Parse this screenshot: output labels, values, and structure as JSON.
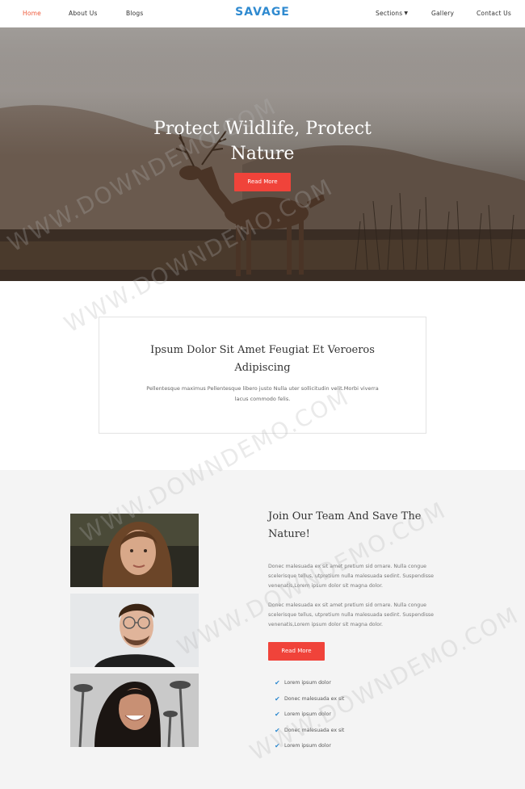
{
  "nav": {
    "logo": "SAVAGE",
    "links": [
      "Home",
      "About Us",
      "Blogs",
      "Sections",
      "Gallery",
      "Contact Us"
    ]
  },
  "hero": {
    "title_line1": "Protect Wildlife, Protect",
    "title_line2": "Nature",
    "button": "Read More"
  },
  "intro": {
    "title_line1": "Ipsum Dolor Sit Amet Feugiat Et Veroeros",
    "title_line2": "Adipiscing",
    "text_line1": "Pellentesque maximus Pellentesque libero justo Nulla uter sollicitudin velit.Morbi viverra",
    "text_line2": "lacus commodo felis."
  },
  "team": {
    "title_line1": "Join Our Team And Save The",
    "title_line2": "Nature!",
    "para1": [
      "Donec malesuada ex sit amet pretium sid ornare. Nulla congue",
      "scelerisque tellus, utpretium nulla malesuada sedint. Suspendisse",
      "venenatis,Lorem ipsum dolor sit magna dolor."
    ],
    "para2": [
      "Donec malesuada ex sit amet pretium sid ornare. Nulla congue",
      "scelerisque tellus, utpretium nulla malesuada sedint. Suspendisse",
      "venenatis,Lorem ipsum dolor sit magna dolor."
    ],
    "button": "Read More",
    "checklist": [
      "Lorem ipsum dolor",
      "Donec malesuada ex sit",
      "Lorem ipsum dolor",
      "Donec malesuada ex sit",
      "Lorem ipsum dolor"
    ]
  },
  "watermark": "WWW.DOWNDEMO.COM",
  "colors": {
    "accent_red": "#f0433a",
    "nav_active": "#ee5a3b",
    "logo_blue": "#2f8ad0"
  }
}
